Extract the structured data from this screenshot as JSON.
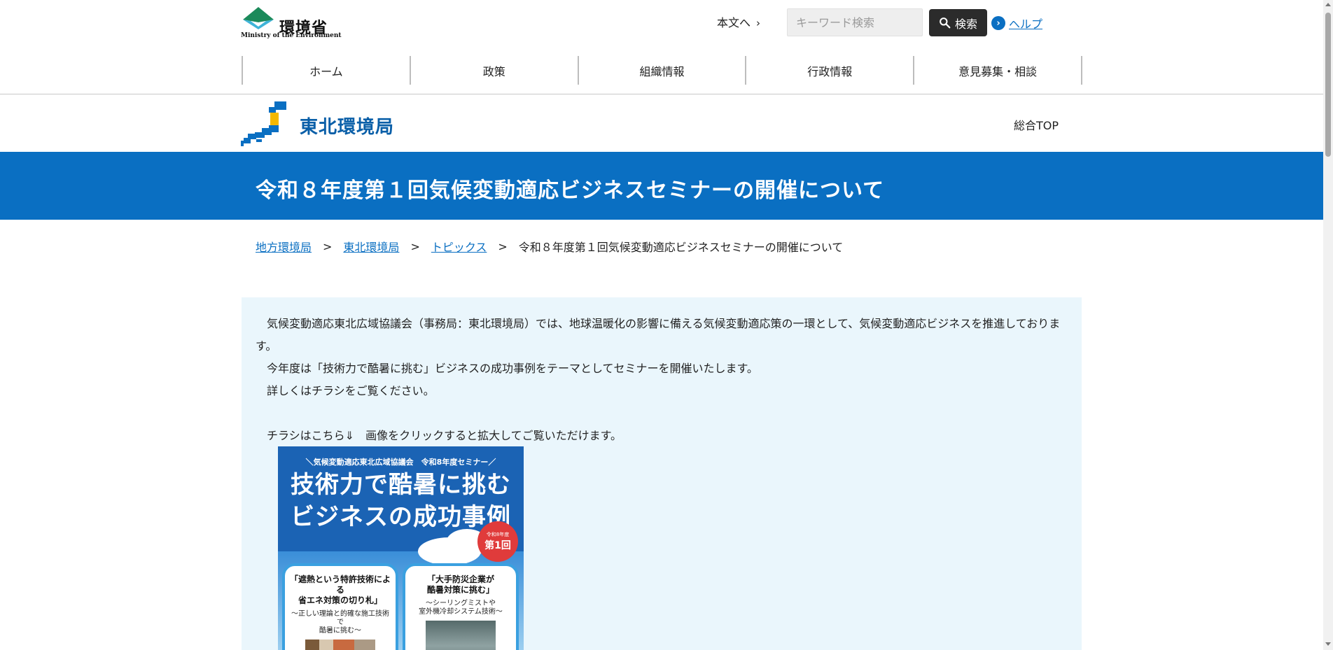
{
  "header": {
    "logo_jp": "環境省",
    "logo_en": "Ministry of the Environment",
    "skip_link": "本文へ",
    "search_placeholder": "キーワード検索",
    "search_button": "検索",
    "help_link": "ヘルプ"
  },
  "global_nav": [
    "ホーム",
    "政策",
    "組織情報",
    "行政情報",
    "意見募集・相談"
  ],
  "bureau": {
    "name": "東北環境局",
    "top_link": "総合TOP"
  },
  "page_title": "令和８年度第１回気候変動適応ビジネスセミナーの開催について",
  "breadcrumb": {
    "items": [
      "地方環境局",
      "東北環境局",
      "トピックス"
    ],
    "separator": ">",
    "current": "令和８年度第１回気候変動適応ビジネスセミナーの開催について"
  },
  "content": {
    "paragraph1": "気候変動適応東北広域協議会（事務局：東北環境局）では、地球温暖化の影響に備える気候変動適応策の一環として、気候変動適応ビジネスを推進しております。",
    "paragraph2": "今年度は「技術力で酷暑に挑む」ビジネスの成功事例をテーマとしてセミナーを開催いたします。",
    "paragraph3": "詳しくはチラシをご覧ください。",
    "paragraph4": "チラシはこちら⇓　画像をクリックすると拡大してご覧いただけます。"
  },
  "flyer": {
    "kicker": "＼気候変動適応東北広域協議会　令和8年度セミナー／",
    "headline_line1": "技術力で酷暑に挑む",
    "headline_line2": "ビジネスの成功事例",
    "badge_small": "令和8年度",
    "badge_big": "第1回",
    "card1_title_line1": "「遮熱という特許技術による",
    "card1_title_line2": "省エネ対策の切り札」",
    "card1_sub_line1": "〜正しい理論と的確な施工技術で",
    "card1_sub_line2": "酷暑に挑む〜",
    "card2_title_line1": "「大手防災企業が",
    "card2_title_line2": "酷暑対策に挑む」",
    "card2_sub_line1": "〜シーリングミストや",
    "card2_sub_line2": "室外機冷却システム技術〜"
  },
  "colors": {
    "brand_blue": "#0a6fc2",
    "content_bg": "#eaf6fc",
    "search_button_bg": "#2b2b2b"
  }
}
